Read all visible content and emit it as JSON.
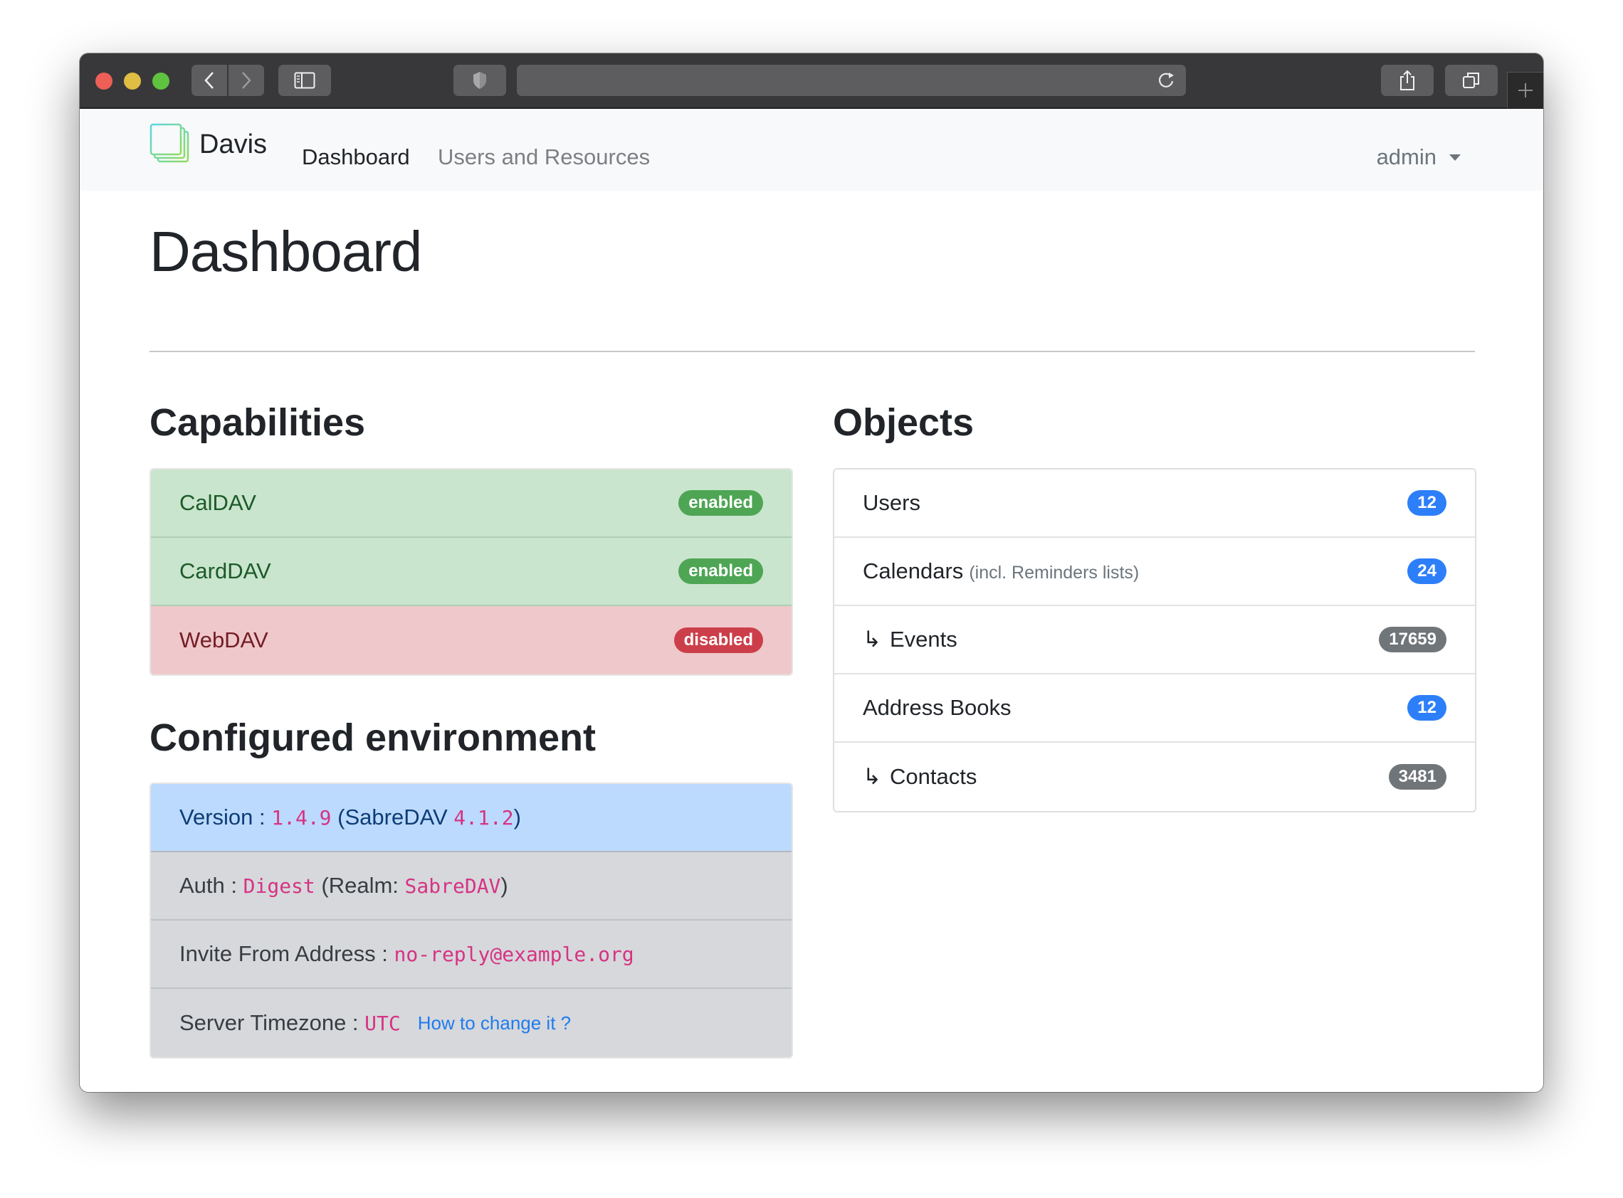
{
  "browser": {
    "traffic_lights": {
      "close": "#ee5f57",
      "minimize": "#e0bd43",
      "maximize": "#60c340"
    },
    "icons": [
      "back-icon",
      "forward-icon",
      "sidebar-icon",
      "shield-icon",
      "reload-icon",
      "share-icon",
      "tabs-overview-icon",
      "new-tab-icon"
    ],
    "url": ""
  },
  "navbar": {
    "brand": "Davis",
    "links": [
      {
        "label": "Dashboard",
        "active": true
      },
      {
        "label": "Users and Resources",
        "active": false
      }
    ],
    "user_menu": "admin"
  },
  "page": {
    "title": "Dashboard"
  },
  "capabilities": {
    "heading": "Capabilities",
    "items": [
      {
        "name": "CalDAV",
        "status": "enabled",
        "color": "#4ea554"
      },
      {
        "name": "CardDAV",
        "status": "enabled",
        "color": "#4ea554"
      },
      {
        "name": "WebDAV",
        "status": "disabled",
        "color": "#cc3f4a"
      }
    ]
  },
  "environment": {
    "heading": "Configured environment",
    "version": {
      "label": "Version :",
      "value": "1.4.9",
      "sabre_prefix": "(SabreDAV",
      "sabre_version": "4.1.2",
      "suffix": ")"
    },
    "auth": {
      "label": "Auth :",
      "value": "Digest",
      "realm_prefix": "(Realm:",
      "realm": "SabreDAV",
      "suffix": ")"
    },
    "invite": {
      "label": "Invite From Address :",
      "value": "no-reply@example.org"
    },
    "timezone": {
      "label": "Server Timezone :",
      "value": "UTC",
      "link": "How to change it ?"
    }
  },
  "objects": {
    "heading": "Objects",
    "items": [
      {
        "label": "Users",
        "note": "",
        "count": "12",
        "child": false,
        "badge_color": "#2d7ff9"
      },
      {
        "label": "Calendars",
        "note": "(incl. Reminders lists)",
        "count": "24",
        "child": false,
        "badge_color": "#2d7ff9"
      },
      {
        "label": "Events",
        "note": "",
        "count": "17659",
        "child": true,
        "badge_color": "#707579"
      },
      {
        "label": "Address Books",
        "note": "",
        "count": "12",
        "child": false,
        "badge_color": "#2d7ff9"
      },
      {
        "label": "Contacts",
        "note": "",
        "count": "3481",
        "child": true,
        "badge_color": "#707579"
      }
    ],
    "child_arrow": "↳"
  }
}
